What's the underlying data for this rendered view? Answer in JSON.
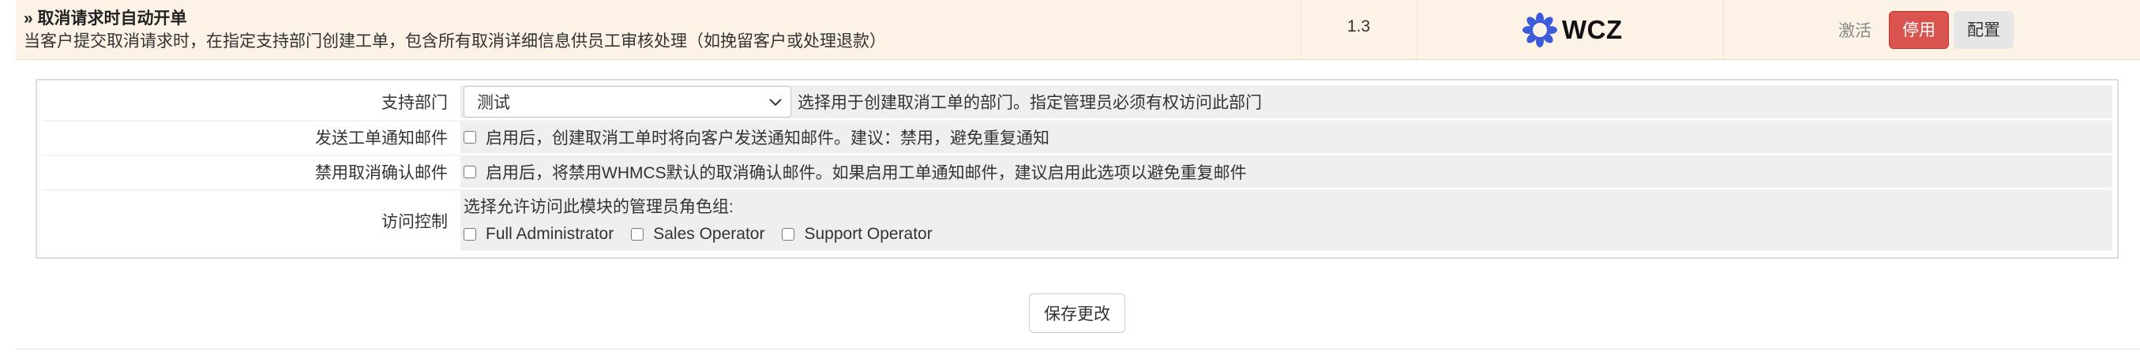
{
  "module": {
    "title": "» 取消请求时自动开单",
    "description": "当客户提交取消请求时，在指定支持部门创建工单，包含所有取消详细信息供员工审核处理（如挽留客户或处理退款）",
    "version": "1.3",
    "logo_text": "WCZ",
    "logo_color": "#3b5bdb",
    "activate_label": "激活",
    "deactivate_label": "停用",
    "configure_label": "配置",
    "row_bg": "#fcf3e6"
  },
  "settings": {
    "department": {
      "label": "支持部门",
      "value": "测试",
      "help": "选择用于创建取消工单的部门。指定管理员必须有权访问此部门"
    },
    "send_notification": {
      "label": "发送工单通知邮件",
      "text": "启用后，创建取消工单时将向客户发送通知邮件。建议：禁用，避免重复通知",
      "checked": false
    },
    "disable_confirmation": {
      "label": "禁用取消确认邮件",
      "text": "启用后，将禁用WHMCS默认的取消确认邮件。如果启用工单通知邮件，建议启用此选项以避免重复邮件",
      "checked": false
    },
    "access_control": {
      "label": "访问控制",
      "prompt": "选择允许访问此模块的管理员角色组:",
      "roles": [
        "Full Administrator",
        "Sales Operator",
        "Support Operator"
      ]
    }
  },
  "save_label": "保存更改",
  "colors": {
    "danger": "#d9534f",
    "field_bg": "#efefef"
  }
}
